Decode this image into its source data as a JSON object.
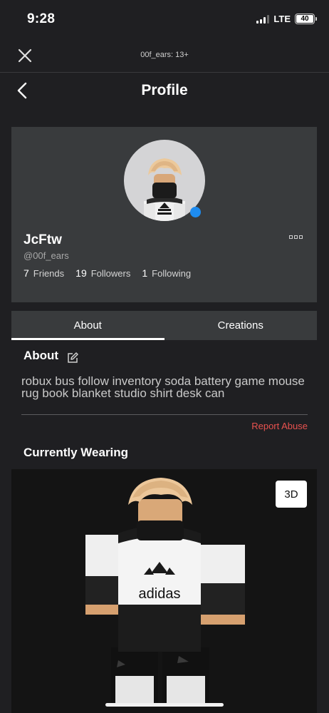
{
  "status_bar": {
    "time": "9:28",
    "network": "LTE",
    "battery": "40"
  },
  "browser": {
    "url": "00f_ears: 13+"
  },
  "header": {
    "title": "Profile"
  },
  "profile": {
    "display_name": "JcFtw",
    "username": "@00f_ears",
    "stats": [
      {
        "count": "7",
        "label": "Friends"
      },
      {
        "count": "19",
        "label": "Followers"
      },
      {
        "count": "1",
        "label": "Following"
      }
    ],
    "online": true,
    "status_color": "#1e8cf0"
  },
  "tabs": [
    {
      "label": "About",
      "active": true
    },
    {
      "label": "Creations",
      "active": false
    }
  ],
  "about": {
    "title": "About",
    "description": "robux bus follow inventory soda battery game mouse rug book blanket studio shirt desk can",
    "report_label": "Report Abuse",
    "report_color": "#e8524f"
  },
  "wearing": {
    "title": "Currently Wearing",
    "view_toggle": "3D",
    "shirt_text": "adidas"
  },
  "icons": [
    "close-icon",
    "back-chevron-icon",
    "more-options-icon",
    "edit-icon",
    "signal-icon",
    "battery-icon"
  ]
}
